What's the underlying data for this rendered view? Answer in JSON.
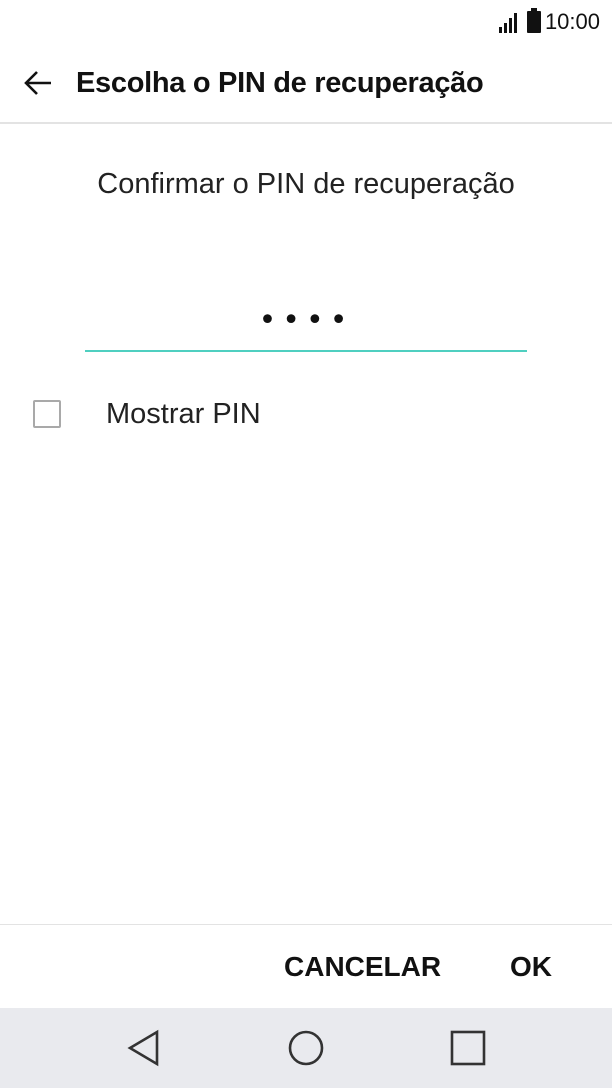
{
  "status_bar": {
    "time": "10:00",
    "icons": [
      "signal-icon",
      "battery-icon"
    ]
  },
  "app_bar": {
    "title": "Escolha o PIN de recuperação",
    "back_icon": "back-arrow-icon"
  },
  "content": {
    "prompt": "Confirmar o PIN de recuperação",
    "pin_value": "••••",
    "show_pin_label": "Mostrar PIN",
    "show_pin_checked": false
  },
  "dialog_buttons": {
    "cancel_label": "CANCELAR",
    "ok_label": "OK"
  },
  "nav_bar": {
    "icons": [
      "nav-back-icon",
      "nav-home-icon",
      "nav-recent-icon"
    ]
  },
  "colors": {
    "accent": "#4fcfc0",
    "nav_background": "#e9eaee",
    "divider": "#e3e3e3"
  }
}
